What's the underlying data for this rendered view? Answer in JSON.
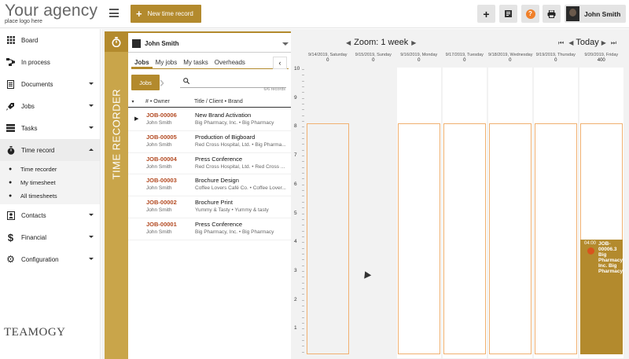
{
  "brand": {
    "name": "Your agency",
    "tagline": "place logo here"
  },
  "topbar": {
    "new_record_label": "New time record",
    "user_name": "John Smith",
    "help_glyph": "?"
  },
  "sidebar": {
    "items": [
      {
        "label": "Board",
        "icon": "grid-icon"
      },
      {
        "label": "In process",
        "icon": "process-icon"
      },
      {
        "label": "Documents",
        "icon": "document-icon"
      },
      {
        "label": "Jobs",
        "icon": "rocket-icon"
      },
      {
        "label": "Tasks",
        "icon": "tasks-icon"
      },
      {
        "label": "Time record",
        "icon": "stopwatch-icon"
      },
      {
        "label": "Contacts",
        "icon": "contacts-icon"
      },
      {
        "label": "Financial",
        "icon": "dollar-icon"
      },
      {
        "label": "Configuration",
        "icon": "gear-icon"
      }
    ],
    "time_record_sub": [
      {
        "label": "Time recorder"
      },
      {
        "label": "My timesheet"
      },
      {
        "label": "All timesheets"
      }
    ],
    "footer_logo": "TEAMOGY"
  },
  "recorder": {
    "label": "TIME RECORDER"
  },
  "jobs_panel": {
    "user_select": "John Smith",
    "tabs": [
      "Jobs",
      "My jobs",
      "My tasks",
      "Overheads"
    ],
    "filter_chip": "Jobs",
    "records_count": "6/6 records",
    "col_number_owner": "# • Owner",
    "col_title_client": "Title / Client • Brand",
    "rows": [
      {
        "id": "JOB-00006",
        "owner": "John Smith",
        "title": "New Brand Activation",
        "client": "Big Pharmacy, Inc. • Big Pharmacy"
      },
      {
        "id": "JOB-00005",
        "owner": "John Smith",
        "title": "Production of Bigboard",
        "client": "Red Cross Hospital, Ltd. • Big Pharma..."
      },
      {
        "id": "JOB-00004",
        "owner": "John Smith",
        "title": "Press Conference",
        "client": "Red Cross Hospital, Ltd. • Red Cross ..."
      },
      {
        "id": "JOB-00003",
        "owner": "John Smith",
        "title": "Brochure Design",
        "client": "Coffee Lovers Café Co. • Coffee Lover..."
      },
      {
        "id": "JOB-00002",
        "owner": "John Smith",
        "title": "Brochure Print",
        "client": "Yummy & Tasty • Yummy & tasty"
      },
      {
        "id": "JOB-00001",
        "owner": "John Smith",
        "title": "Press Conference",
        "client": "Big Pharmacy, Inc. • Big Pharmacy"
      }
    ]
  },
  "calendar": {
    "zoom_label": "Zoom: 1 week",
    "today_label": "Today",
    "days": [
      {
        "date": "9/14/2019, Saturday",
        "total": "0",
        "weekend": true
      },
      {
        "date": "9/15/2019, Sunday",
        "total": "0",
        "weekend": true
      },
      {
        "date": "9/16/2019, Monday",
        "total": "0",
        "weekend": false
      },
      {
        "date": "9/17/2019, Tuesday",
        "total": "0",
        "weekend": false
      },
      {
        "date": "9/18/2019, Wednesday",
        "total": "0",
        "weekend": false
      },
      {
        "date": "9/19/2019, Thursday",
        "total": "0",
        "weekend": false
      },
      {
        "date": "9/20/2019, Friday",
        "total": "400",
        "weekend": false
      }
    ],
    "y_labels": [
      "10",
      "9",
      "8",
      "7",
      "6",
      "5",
      "4",
      "3",
      "2",
      "1"
    ],
    "event": {
      "time": "04:00",
      "text": "JOB-00006.3 Big Pharmacy, Inc. Big Pharmacy"
    }
  },
  "colors": {
    "accent": "#b38a2d",
    "accent_light": "#c9a54a",
    "job_id": "#b34a22",
    "slot_border": "#f0b070"
  }
}
